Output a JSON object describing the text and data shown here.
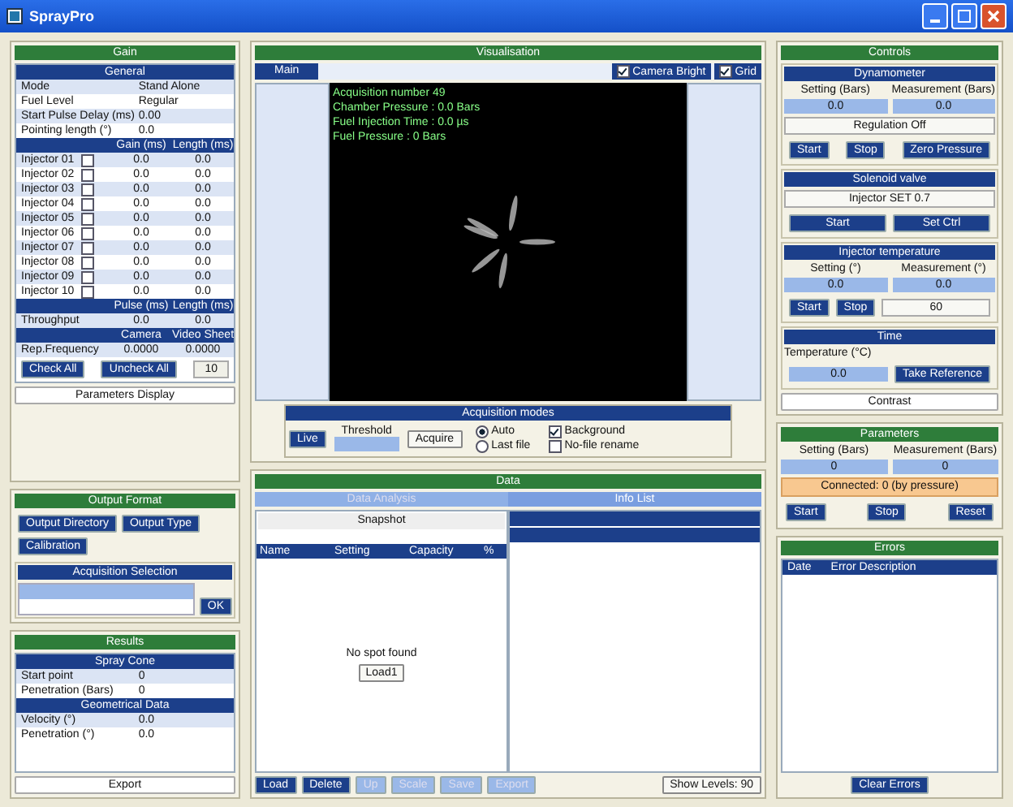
{
  "window": {
    "title": "SprayPro"
  },
  "gain": {
    "title": "Gain",
    "general": {
      "title": "General",
      "rows": [
        {
          "label": "Mode",
          "value": "Stand Alone"
        },
        {
          "label": "Fuel Level",
          "value": "Regular"
        },
        {
          "label": "Start Pulse Delay (ms)",
          "value": "0.00"
        },
        {
          "label": "Pointing length (°)",
          "value": "0.0"
        }
      ]
    },
    "injectors": {
      "columns": [
        "Gain (ms)",
        "Length (ms)"
      ],
      "rows": [
        {
          "label": "Injector 01",
          "checked": false,
          "gain": "0.0",
          "length": "0.0"
        },
        {
          "label": "Injector 02",
          "checked": false,
          "gain": "0.0",
          "length": "0.0"
        },
        {
          "label": "Injector 03",
          "checked": false,
          "gain": "0.0",
          "length": "0.0"
        },
        {
          "label": "Injector 04",
          "checked": false,
          "gain": "0.0",
          "length": "0.0"
        },
        {
          "label": "Injector 05",
          "checked": false,
          "gain": "0.0",
          "length": "0.0"
        },
        {
          "label": "Injector 06",
          "checked": false,
          "gain": "0.0",
          "length": "0.0"
        },
        {
          "label": "Injector 07",
          "checked": false,
          "gain": "0.0",
          "length": "0.0"
        },
        {
          "label": "Injector 08",
          "checked": false,
          "gain": "0.0",
          "length": "0.0"
        },
        {
          "label": "Injector 09",
          "checked": false,
          "gain": "0.0",
          "length": "0.0"
        },
        {
          "label": "Injector 10",
          "checked": false,
          "gain": "0.0",
          "length": "0.0"
        }
      ]
    },
    "trigger": {
      "columns": [
        "Pulse (ms)",
        "Length (ms)"
      ],
      "label": "Throughput",
      "values": [
        "0.0",
        "0.0"
      ]
    },
    "sampling": {
      "columns": [
        "Camera",
        "Video Sheet"
      ],
      "label": "Rep.Frequency",
      "values": [
        "0.0000",
        "0.0000"
      ]
    },
    "buttons": [
      "Check All",
      "Uncheck All"
    ],
    "count": "10",
    "footer": "Parameters Display"
  },
  "output": {
    "title": "Output Format",
    "buttons": [
      "Output Directory",
      "Output Type",
      "Calibration"
    ],
    "selection": {
      "title": "Acquisition Selection",
      "ok": "OK"
    }
  },
  "results": {
    "title": "Results",
    "groups": [
      {
        "title": "Spray Cone",
        "rows": [
          {
            "label": "Start point",
            "value": "0"
          },
          {
            "label": "Penetration (Bars)",
            "value": "0"
          }
        ]
      },
      {
        "title": "Geometrical Data",
        "rows": [
          {
            "label": "Velocity (°)",
            "value": "0.0"
          },
          {
            "label": "Penetration (°)",
            "value": "0.0"
          }
        ]
      }
    ],
    "footer": "Export"
  },
  "visualisation": {
    "title": "Visualisation",
    "tabs": [
      {
        "label": "Main",
        "selected": true
      }
    ],
    "options": [
      {
        "label": "Camera Bright",
        "checked": true
      },
      {
        "label": "Grid",
        "checked": true
      }
    ],
    "overlay": [
      "Acquisition number 49",
      "Chamber Pressure : 0.0 Bars",
      "Fuel Injection Time : 0.0 µs",
      "Fuel Pressure : 0 Bars"
    ],
    "acquisition": {
      "title": "Acquisition modes",
      "live": "Live",
      "threshold": "Threshold",
      "acquire": "Acquire",
      "radios": [
        {
          "label": "Auto",
          "selected": true
        },
        {
          "label": "Last file",
          "selected": false
        }
      ],
      "checks": [
        {
          "label": "Background",
          "checked": true
        },
        {
          "label": "No-file rename",
          "checked": false
        }
      ]
    }
  },
  "data": {
    "title": "Data",
    "tabs": [
      {
        "label": "Data Analysis",
        "selected": false
      },
      {
        "label": "Info List",
        "selected": true
      }
    ],
    "snapshot": "Snapshot",
    "columns": [
      "Name",
      "Setting",
      "Capacity",
      "%"
    ],
    "empty": "No spot found",
    "load": "Load1",
    "buttons": [
      {
        "label": "Load",
        "disabled": false
      },
      {
        "label": "Delete",
        "disabled": false
      },
      {
        "label": "Up",
        "disabled": true
      },
      {
        "label": "Scale",
        "disabled": true
      },
      {
        "label": "Save",
        "disabled": true
      },
      {
        "label": "Export",
        "disabled": true
      }
    ],
    "levels": "Show Levels: 90"
  },
  "controls": {
    "title": "Controls",
    "dyn": {
      "title": "Dynamometer",
      "labels": [
        "Setting (Bars)",
        "Measurement (Bars)"
      ],
      "values": [
        "0.0",
        "0.0"
      ],
      "regulation": "Regulation Off",
      "buttons": [
        "Start",
        "Stop",
        "Zero Pressure"
      ]
    },
    "valve": {
      "title": "Solenoid valve",
      "value": "Injector SET 0.7",
      "buttons": [
        "Start",
        "Set Ctrl"
      ]
    },
    "temp": {
      "title": "Injector temperature",
      "labels": [
        "Setting (°)",
        "Measurement (°)"
      ],
      "values": [
        "0.0",
        "0.0"
      ],
      "buttons": [
        "Start",
        "Stop"
      ],
      "field": "60"
    },
    "time": {
      "title": "Time",
      "label": "Temperature (°C)",
      "value": "0.0",
      "button": "Take Reference"
    },
    "footer": "Contrast"
  },
  "parameters": {
    "title": "Parameters",
    "labels": [
      "Setting (Bars)",
      "Measurement (Bars)"
    ],
    "values": [
      "0",
      "0"
    ],
    "status": "Connected: 0 (by pressure)",
    "buttons": [
      "Start",
      "Stop",
      "Reset"
    ]
  },
  "errors": {
    "title": "Errors",
    "columns": [
      "Date",
      "Error Description"
    ],
    "button": "Clear Errors"
  }
}
